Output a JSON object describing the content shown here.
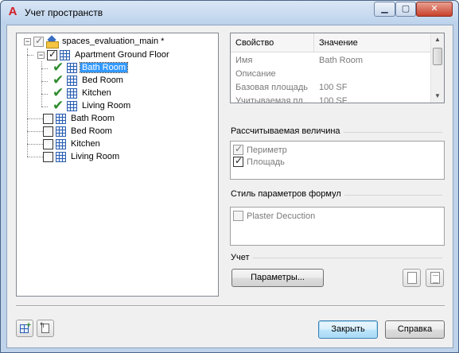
{
  "window": {
    "title": "Учет пространств",
    "app_icon_glyph": "A",
    "controls": {
      "minimize": "▁",
      "maximize": "▢",
      "close": "✕"
    }
  },
  "tree": {
    "root": {
      "label": "spaces_evaluation_main *",
      "expander": "−",
      "checked": true
    },
    "floor": {
      "label": "Apartment Ground Floor",
      "expander": "−",
      "checked": true
    },
    "floor_children": [
      {
        "label": "Bath Room",
        "selected": true
      },
      {
        "label": "Bed Room"
      },
      {
        "label": "Kitchen"
      },
      {
        "label": "Living Room"
      }
    ],
    "root_children": [
      {
        "label": "Bath Room",
        "checked": false
      },
      {
        "label": "Bed Room",
        "checked": false
      },
      {
        "label": "Kitchen",
        "checked": false
      },
      {
        "label": "Living Room",
        "checked": false
      }
    ]
  },
  "properties": {
    "headers": {
      "property": "Свойство",
      "value": "Значение"
    },
    "rows": [
      {
        "property": "Имя",
        "value": "Bath Room"
      },
      {
        "property": "Описание",
        "value": ""
      },
      {
        "property": "Базовая площадь",
        "value": "100  SF"
      },
      {
        "property": "Учитываемая пл...",
        "value": "100  SF"
      }
    ],
    "scroll_up": "▲",
    "scroll_down": "▼"
  },
  "calculated": {
    "title": "Рассчитываемая величина",
    "options": [
      {
        "label": "Периметр",
        "checked": true
      },
      {
        "label": "Площадь",
        "checked": true
      }
    ]
  },
  "formula_style": {
    "title": "Стиль параметров формул",
    "options": [
      {
        "label": "Plaster Decuction",
        "checked": false
      }
    ]
  },
  "report": {
    "title": "Учет",
    "params_button": "Параметры..."
  },
  "footer": {
    "close_button": "Закрыть",
    "help_button": "Справка"
  }
}
